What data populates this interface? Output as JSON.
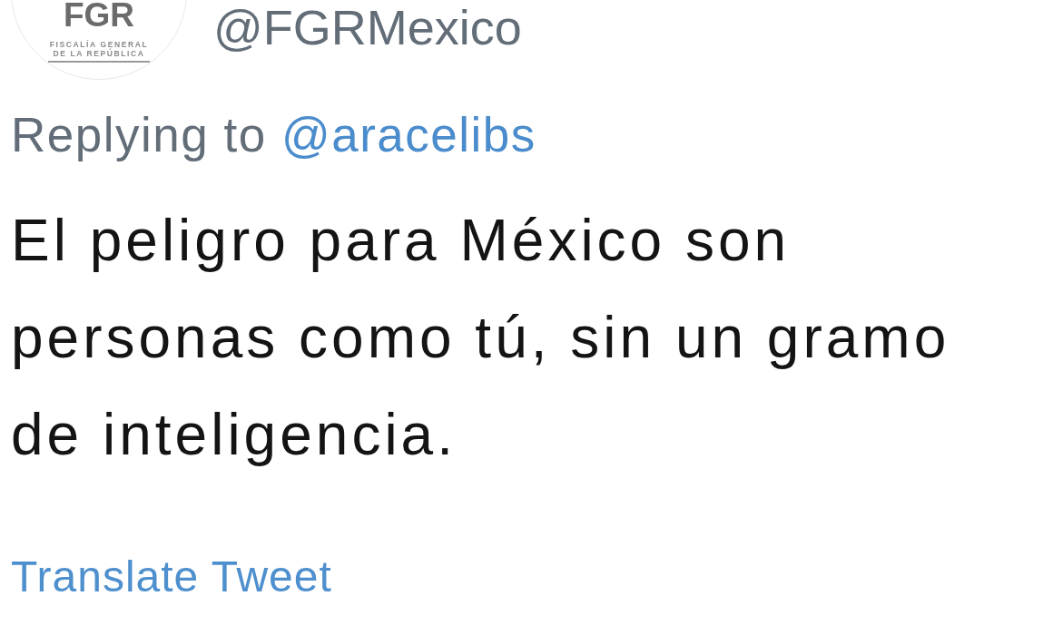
{
  "tweet": {
    "author": {
      "avatar": {
        "logo_title": "FGR",
        "logo_subtitle_lines": [
          "FISCALÍA GENERAL",
          "DE LA REPÚBLICA"
        ]
      },
      "handle": "@FGRMexico"
    },
    "reply_context": {
      "label": "Replying to",
      "mention": "@aracelibs"
    },
    "text": "El peligro para México son personas como tú, sin un gramo de inteligencia.",
    "translate_link": "Translate Tweet"
  }
}
